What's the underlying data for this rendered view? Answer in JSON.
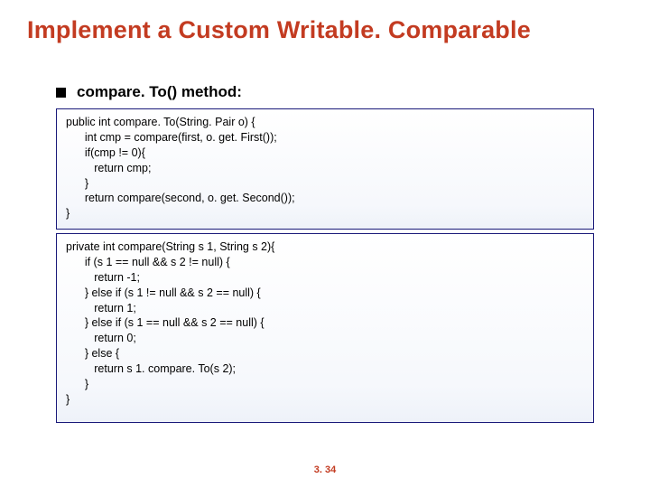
{
  "title": "Implement a Custom Writable. Comparable",
  "bullet": "compare. To() method:",
  "code1": "public int compare. To(String. Pair o) {\n      int cmp = compare(first, o. get. First());\n      if(cmp != 0){\n         return cmp;\n      }\n      return compare(second, o. get. Second());\n}",
  "code2": "private int compare(String s 1, String s 2){\n      if (s 1 == null && s 2 != null) {\n         return -1;\n      } else if (s 1 != null && s 2 == null) {\n         return 1;\n      } else if (s 1 == null && s 2 == null) {\n         return 0;\n      } else {\n         return s 1. compare. To(s 2);\n      }\n}",
  "page": "3. 34"
}
